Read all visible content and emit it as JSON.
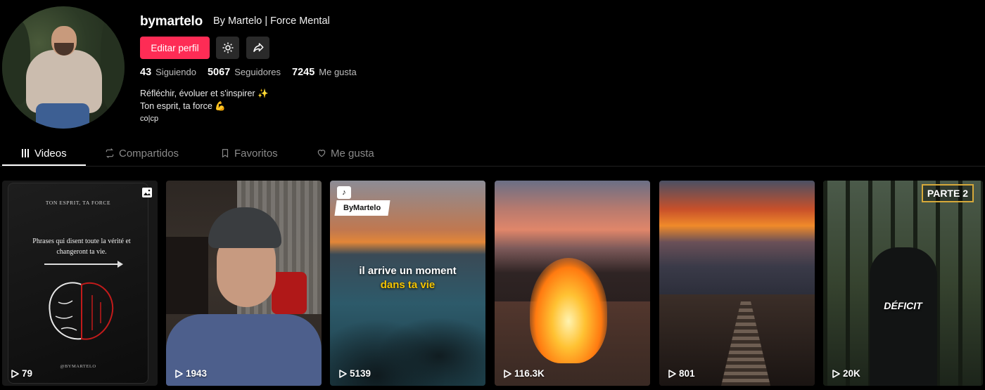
{
  "profile": {
    "username": "bymartelo",
    "nickname": "By Martelo | Force Mental",
    "edit_label": "Editar perfil",
    "settings_icon": "gear-icon",
    "share_icon": "share-icon",
    "stats": {
      "following_count": "43",
      "following_label": "Siguiendo",
      "followers_count": "5067",
      "followers_label": "Seguidores",
      "likes_count": "7245",
      "likes_label": "Me gusta"
    },
    "bio": {
      "line1": "Réfléchir, évoluer et s'inspirer ✨",
      "line2": "Ton esprit, ta force 💪",
      "line3": "co|cp"
    }
  },
  "tabs": [
    {
      "label": "Videos",
      "icon": "grid-icon",
      "active": true
    },
    {
      "label": "Compartidos",
      "icon": "repost-icon",
      "active": false
    },
    {
      "label": "Favoritos",
      "icon": "bookmark-icon",
      "active": false
    },
    {
      "label": "Me gusta",
      "icon": "heart-icon",
      "active": false
    }
  ],
  "videos": [
    {
      "views": "79",
      "overlay": {
        "title": "TON ESPRIT, TA FORCE",
        "quote": "Phrases qui disent toute la vérité et changeront ta vie.",
        "footer": "@BYMARTELO"
      },
      "type_icon": "photo-carousel-icon"
    },
    {
      "views": "1943"
    },
    {
      "views": "5139",
      "overlay": {
        "author": "ByMartelo",
        "caption_white": "il arrive un moment",
        "caption_yellow": "dans ta vie"
      }
    },
    {
      "views": "116.3K"
    },
    {
      "views": "801"
    },
    {
      "views": "20K",
      "overlay": {
        "tag": "PARTE 2",
        "caption": "DÉFICIT"
      }
    }
  ],
  "colors": {
    "accent": "#fe2c55",
    "background": "#000000",
    "muted_text": "#8a8a8a"
  }
}
